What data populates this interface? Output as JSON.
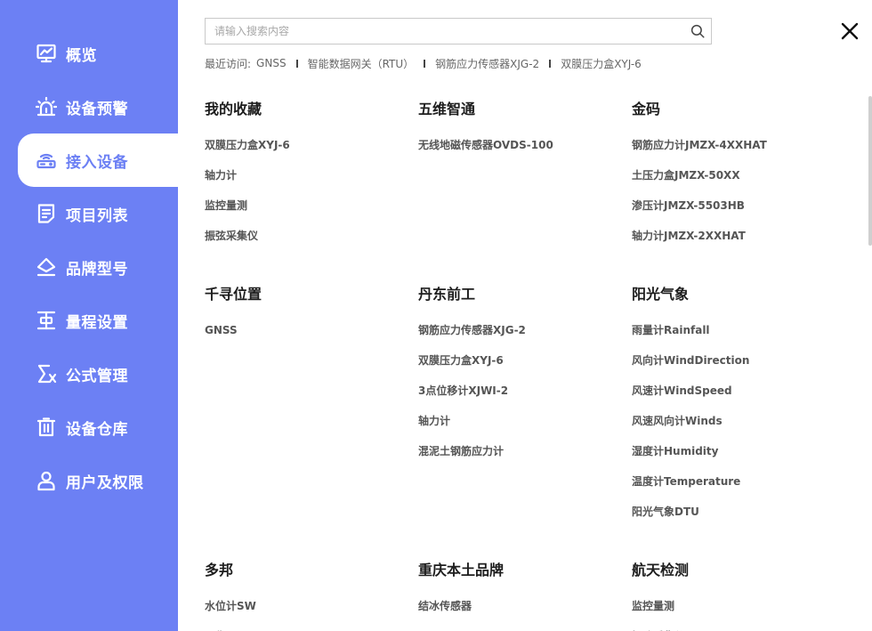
{
  "sidebar": {
    "items": [
      {
        "label": "概览",
        "icon": "chart-board-icon"
      },
      {
        "label": "设备预警",
        "icon": "alarm-icon"
      },
      {
        "label": "接入设备",
        "icon": "router-icon"
      },
      {
        "label": "项目列表",
        "icon": "document-list-icon"
      },
      {
        "label": "品牌型号",
        "icon": "brand-icon"
      },
      {
        "label": "量程设置",
        "icon": "range-icon"
      },
      {
        "label": "公式管理",
        "icon": "formula-icon"
      },
      {
        "label": "设备仓库",
        "icon": "trash-bin-icon"
      },
      {
        "label": "用户及权限",
        "icon": "user-icon"
      }
    ],
    "active_index": 2
  },
  "search": {
    "placeholder": "请输入搜索内容",
    "value": ""
  },
  "recent": {
    "label": "最近访问:",
    "items": [
      "GNSS",
      "智能数据网关（RTU）",
      "钢筋应力传感器XJG-2",
      "双膜压力盒XYJ-6"
    ]
  },
  "groups": [
    {
      "title": "我的收藏",
      "items": [
        "双膜压力盒XYJ-6",
        "轴力计",
        "监控量测",
        "振弦采集仪"
      ]
    },
    {
      "title": "五维智通",
      "items": [
        "无线地磁传感器OVDS-100"
      ]
    },
    {
      "title": "金码",
      "items": [
        "钢筋应力计JMZX-4XXHAT",
        "土压力盒JMZX-50XX",
        "渗压计JMZX-5503HB",
        "轴力计JMZX-2XXHAT"
      ]
    },
    {
      "title": "千寻位置",
      "items": [
        "GNSS"
      ]
    },
    {
      "title": "丹东前工",
      "items": [
        "钢筋应力传感器XJG-2",
        "双膜压力盒XYJ-6",
        "3点位移计XJWI-2",
        "轴力计",
        "混泥土钢筋应力计"
      ]
    },
    {
      "title": "阳光气象",
      "items": [
        "雨量计Rainfall",
        "风向计WindDirection",
        "风速计WindSpeed",
        "风速风向计Winds",
        "湿度计Humidity",
        "温度计Temperature",
        "阳光气象DTU"
      ]
    },
    {
      "title": "多邦",
      "items": [
        "水位计SW",
        "图像IMAGE"
      ]
    },
    {
      "title": "重庆本土品牌",
      "items": [
        "结冰传感器"
      ]
    },
    {
      "title": "航天检测",
      "items": [
        "监控量测",
        "振弦采集仪"
      ]
    }
  ],
  "colors": {
    "sidebar_bg": "#6c80f4",
    "active_text": "#6c80f4"
  }
}
